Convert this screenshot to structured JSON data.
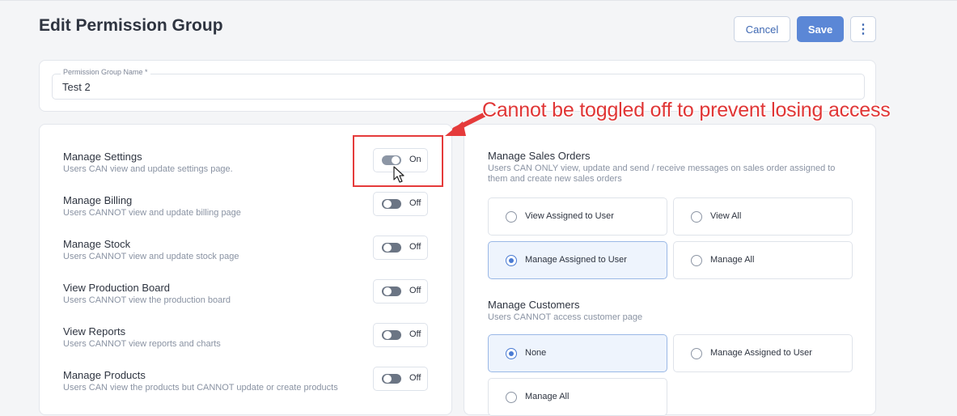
{
  "header": {
    "title": "Edit Permission Group",
    "cancel_label": "Cancel",
    "save_label": "Save",
    "more_label": "⋮"
  },
  "group_name": {
    "label": "Permission Group Name *",
    "value": "Test 2"
  },
  "left_permissions": [
    {
      "title": "Manage Settings",
      "desc": "Users CAN view and update settings page.",
      "state": "On"
    },
    {
      "title": "Manage Billing",
      "desc": "Users CANNOT view and update billing page",
      "state": "Off"
    },
    {
      "title": "Manage Stock",
      "desc": "Users CANNOT view and update stock page",
      "state": "Off"
    },
    {
      "title": "View Production Board",
      "desc": "Users CANNOT view the production board",
      "state": "Off"
    },
    {
      "title": "View Reports",
      "desc": "Users CANNOT view reports and charts",
      "state": "Off"
    },
    {
      "title": "Manage Products",
      "desc": "Users CAN view the products but CANNOT update or create products",
      "state": "Off"
    }
  ],
  "sales_orders": {
    "title": "Manage Sales Orders",
    "desc": "Users CAN ONLY view, update and send / receive messages on sales order assigned to them and create new sales orders",
    "options": [
      {
        "label": "View Assigned to User",
        "selected": false
      },
      {
        "label": "View All",
        "selected": false
      },
      {
        "label": "Manage Assigned to User",
        "selected": true
      },
      {
        "label": "Manage All",
        "selected": false
      }
    ]
  },
  "customers": {
    "title": "Manage Customers",
    "desc": "Users CANNOT access customer page",
    "options": [
      {
        "label": "None",
        "selected": true
      },
      {
        "label": "Manage Assigned to User",
        "selected": false
      },
      {
        "label": "Manage All",
        "selected": false
      }
    ]
  },
  "annotation": {
    "text": "Cannot be toggled off to prevent losing access",
    "color": "#e03636"
  },
  "colors": {
    "accent": "#5b87d6",
    "selected_bg": "#eef4fd"
  }
}
